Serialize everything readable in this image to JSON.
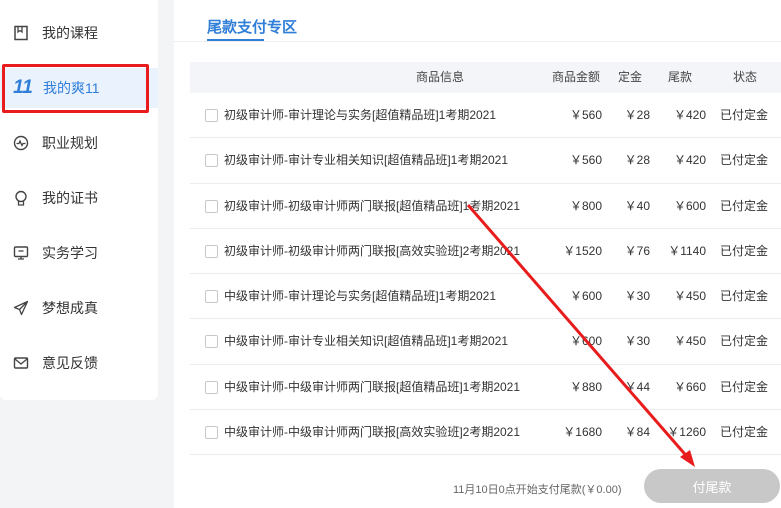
{
  "sidebar": {
    "items": [
      {
        "label": "我的课程",
        "icon": "bookmark-icon"
      },
      {
        "label": "我的爽11",
        "icon": "eleven-icon",
        "icon_text": "11",
        "active": true
      },
      {
        "label": "职业规划",
        "icon": "pulse-icon"
      },
      {
        "label": "我的证书",
        "icon": "badge-icon"
      },
      {
        "label": "实务学习",
        "icon": "monitor-icon"
      },
      {
        "label": "梦想成真",
        "icon": "paper-plane-icon"
      },
      {
        "label": "意见反馈",
        "icon": "mail-icon"
      }
    ]
  },
  "main": {
    "tab_label": "尾款支付专区",
    "table": {
      "headers": {
        "info": "商品信息",
        "price": "商品金额",
        "deposit": "定金",
        "balance": "尾款",
        "status": "状态"
      },
      "rows": [
        {
          "name": "初级审计师-审计理论与实务[超值精品班]1考期2021",
          "price": "￥560",
          "deposit": "￥28",
          "balance": "￥420",
          "status": "已付定金"
        },
        {
          "name": "初级审计师-审计专业相关知识[超值精品班]1考期2021",
          "price": "￥560",
          "deposit": "￥28",
          "balance": "￥420",
          "status": "已付定金"
        },
        {
          "name": "初级审计师-初级审计师两门联报[超值精品班]1考期2021",
          "price": "￥800",
          "deposit": "￥40",
          "balance": "￥600",
          "status": "已付定金"
        },
        {
          "name": "初级审计师-初级审计师两门联报[高效实验班]2考期2021",
          "price": "￥1520",
          "deposit": "￥76",
          "balance": "￥1140",
          "status": "已付定金"
        },
        {
          "name": "中级审计师-审计理论与实务[超值精品班]1考期2021",
          "price": "￥600",
          "deposit": "￥30",
          "balance": "￥450",
          "status": "已付定金"
        },
        {
          "name": "中级审计师-审计专业相关知识[超值精品班]1考期2021",
          "price": "￥600",
          "deposit": "￥30",
          "balance": "￥450",
          "status": "已付定金"
        },
        {
          "name": "中级审计师-中级审计师两门联报[超值精品班]1考期2021",
          "price": "￥880",
          "deposit": "￥44",
          "balance": "￥660",
          "status": "已付定金"
        },
        {
          "name": "中级审计师-中级审计师两门联报[高效实验班]2考期2021",
          "price": "￥1680",
          "deposit": "￥84",
          "balance": "￥1260",
          "status": "已付定金"
        }
      ]
    },
    "footer": {
      "note": "11月10日0点开始支付尾款(￥0.00)",
      "pay_button": "付尾款"
    }
  },
  "colors": {
    "accent": "#2f7ed8",
    "annotation_red": "#e81c1c",
    "button_disabled": "#c8c8c8"
  }
}
